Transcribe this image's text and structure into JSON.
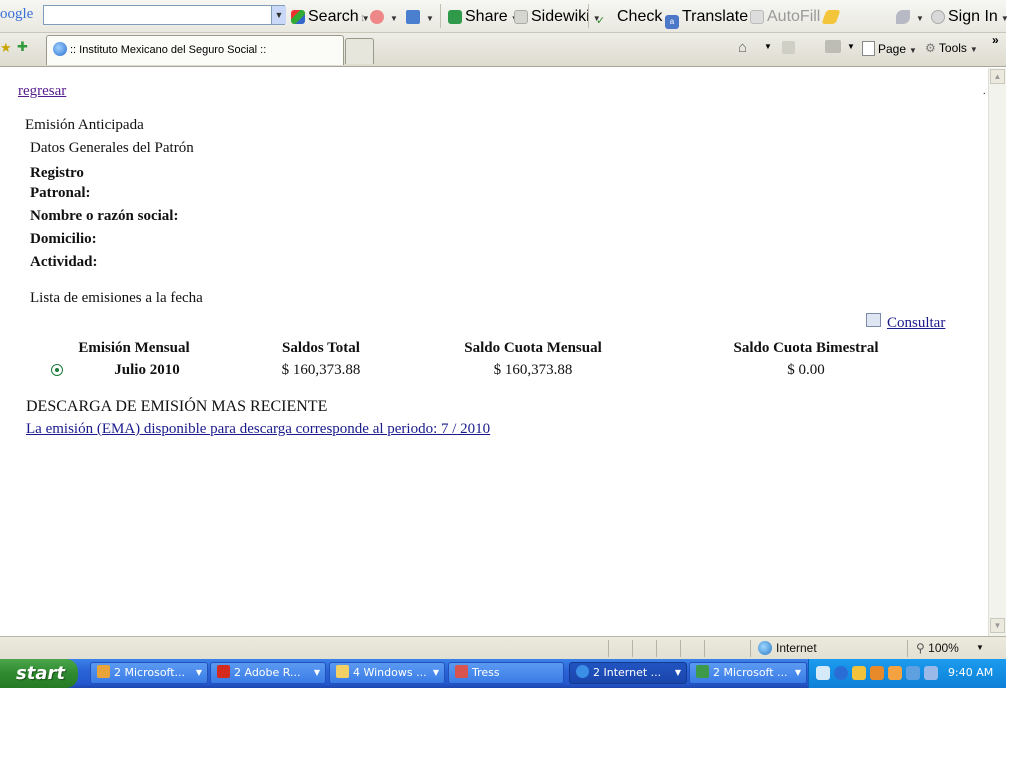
{
  "toolbar": {
    "logo_text": "oogle",
    "search_value": "",
    "search_label": "Search",
    "share_label": "Share",
    "sidewiki_label": "Sidewiki",
    "check_label": "Check",
    "translate_label": "Translate",
    "autofill_label": "AutoFill",
    "signin_label": "Sign In",
    "more_chevron": "»"
  },
  "tabs": {
    "active_tab_title": ":: Instituto Mexicano del Seguro Social ::",
    "page_label": "Page",
    "tools_label": "Tools"
  },
  "page": {
    "back_link": "regresar",
    "title": "Emisión Anticipada",
    "section_general": "Datos Generales del Patrón",
    "field_registro_1": "Registro",
    "field_registro_2": "Patronal:",
    "field_nombre": "Nombre o razón social:",
    "field_domicilio": "Domicilio:",
    "field_actividad": "Actividad:",
    "section_list": "Lista de emisiones a la fecha",
    "consultar_link": "Consultar",
    "table": {
      "headers": [
        "Emisión Mensual",
        "Saldos Total",
        "Saldo Cuota Mensual",
        "Saldo Cuota Bimestral"
      ],
      "rows": [
        {
          "emision": "Julio 2010",
          "saldo_total": "$ 160,373.88",
          "cuota_mensual": "$ 160,373.88",
          "cuota_bimestral": "$ 0.00",
          "selected": true
        }
      ]
    },
    "download_heading": "DESCARGA DE EMISIÓN MAS RECIENTE",
    "download_link": "La emisión (EMA) disponible para descarga corresponde al periodo: 7 / 2010"
  },
  "statusbar": {
    "zone_label": "Internet",
    "zoom": "100%"
  },
  "taskbar": {
    "start_label": "start",
    "tasks": [
      {
        "label": "2 Microsoft...",
        "icon_color": "#e8a33a"
      },
      {
        "label": "2 Adobe R...",
        "icon_color": "#d42b1e"
      },
      {
        "label": "4 Windows ...",
        "icon_color": "#f3d064"
      },
      {
        "label": "Tress",
        "icon_color": "#d9534f"
      },
      {
        "label": "2 Internet ...",
        "icon_color": "#3a8ee6"
      },
      {
        "label": "2 Microsoft ...",
        "icon_color": "#3c9a4a"
      }
    ],
    "clock": "9:40 AM"
  },
  "colors": {
    "link": "#1a1a8c",
    "visited_link": "#551a8b",
    "taskbar_blue": "#2458cf",
    "start_green": "#2f8a2f"
  }
}
